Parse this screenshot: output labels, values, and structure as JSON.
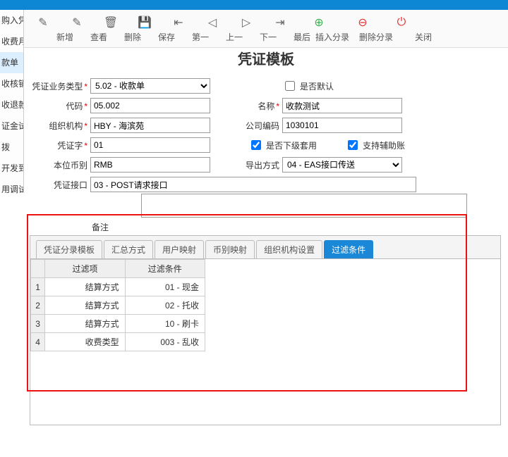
{
  "titlebar": {},
  "sidebar": {
    "items": [
      "购入凭",
      "收费月",
      "款单",
      "收核销",
      "收退款",
      "证金试",
      "拨",
      "开发到",
      "用调试"
    ],
    "active_index": 2
  },
  "toolbar": {
    "items": [
      {
        "icon": "new-icon",
        "glyph": "✎",
        "label": "新增"
      },
      {
        "icon": "view-icon",
        "glyph": "✎",
        "label": "查看"
      },
      {
        "icon": "delete-icon",
        "glyph": "🗑",
        "label": "删除"
      },
      {
        "icon": "save-icon",
        "glyph": "💾",
        "label": "保存"
      },
      {
        "icon": "first-icon",
        "glyph": "⇤",
        "label": "第一"
      },
      {
        "icon": "prev-icon",
        "glyph": "◁",
        "label": "上一"
      },
      {
        "icon": "next-icon",
        "glyph": "▷",
        "label": "下一"
      },
      {
        "icon": "last-icon",
        "glyph": "⇥",
        "label": "最后"
      },
      {
        "icon": "insert-entry-icon",
        "glyph": "⊕",
        "label": "插入分录",
        "color": "green",
        "wide": true
      },
      {
        "icon": "delete-entry-icon",
        "glyph": "⊖",
        "label": "删除分录",
        "color": "red",
        "wide": true
      },
      {
        "icon": "close-icon",
        "glyph": "⏻",
        "label": "关闭",
        "color": "red"
      }
    ]
  },
  "heading": "凭证模板",
  "form": {
    "biz_type_label": "凭证业务类型",
    "biz_type_value": "5.02 - 收款单",
    "default_label": "是否默认",
    "default_checked": false,
    "code_label": "代码",
    "code_value": "05.002",
    "name_label": "名称",
    "name_value": "收款测试",
    "org_label": "组织机构",
    "org_value": "HBY - 海滨苑",
    "company_code_label": "公司编码",
    "company_code_value": "1030101",
    "voucher_word_label": "凭证字",
    "voucher_word_value": "01",
    "sub_apply_label": "是否下级套用",
    "sub_apply_checked": true,
    "support_aux_label": "支持辅助账",
    "support_aux_checked": true,
    "base_ccy_label": "本位币别",
    "base_ccy_value": "RMB",
    "export_mode_label": "导出方式",
    "export_mode_value": "04 - EAS接口传送",
    "voucher_if_label": "凭证接口",
    "voucher_if_value": "03 - POST请求接口",
    "remarks_label": "备注",
    "remarks_value": ""
  },
  "tabs": {
    "items": [
      "凭证分录模板",
      "汇总方式",
      "用户映射",
      "币别映射",
      "组织机构设置",
      "过滤条件"
    ],
    "active_index": 5,
    "grid": {
      "headers": [
        "过滤项",
        "过滤条件"
      ],
      "rows": [
        {
          "n": "1",
          "item": "结算方式",
          "cond": "01 - 现金"
        },
        {
          "n": "2",
          "item": "结算方式",
          "cond": "02 - 托收"
        },
        {
          "n": "3",
          "item": "结算方式",
          "cond": "10 - 刷卡"
        },
        {
          "n": "4",
          "item": "收费类型",
          "cond": "003 - 乱收"
        }
      ]
    }
  }
}
